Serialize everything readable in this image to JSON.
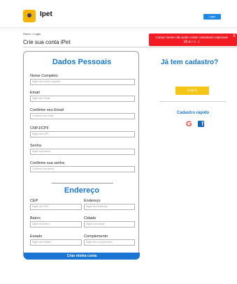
{
  "header": {
    "brand": "Ipet",
    "login_label": "Login"
  },
  "breadcrumb": "Home > Login",
  "page_subtitle": "Crie sua conta iPet",
  "toast": {
    "message": "Campo Nome não pode conter caracteres especiais (@,&,*,A...)",
    "close": "X"
  },
  "personal": {
    "title": "Dados Pessoais",
    "fields": [
      {
        "label": "Nome Completo",
        "placeholder": "Digite seu nome completo"
      },
      {
        "label": "Email",
        "placeholder": "Digite seu Email"
      },
      {
        "label": "Confirme seu Email",
        "placeholder": "Confirme seu email"
      },
      {
        "label": "CNPJ/CPF",
        "placeholder": "Digite seu CPF"
      },
      {
        "label": "Senha",
        "placeholder": "Digite sua senha"
      },
      {
        "label": "Confirme sua senha",
        "placeholder": "Confirme sua senha"
      }
    ]
  },
  "address": {
    "title": "Endereço",
    "fields": [
      {
        "label": "CEP",
        "placeholder": "Digite seu CEP"
      },
      {
        "label": "Endereço",
        "placeholder": "Digite seu endereço"
      },
      {
        "label": "Bairro",
        "placeholder": "Digite seu bairro"
      },
      {
        "label": "Cidade",
        "placeholder": "Digite sua cidade"
      },
      {
        "label": "Estado",
        "placeholder": "Digite seu estado"
      },
      {
        "label": "Complemento",
        "placeholder": "Digite seu complemento"
      }
    ]
  },
  "create_button": "Criar minha conta",
  "sidebar": {
    "title": "Já tem cadastro?",
    "login_button": "Log in",
    "quick_title": "Cadastro rápido",
    "google_glyph": "G",
    "facebook_glyph": "f"
  },
  "icons": {
    "logo": "paw-logo-icon",
    "google": "google-icon",
    "facebook": "facebook-icon"
  },
  "colors": {
    "accent": "#1976d2",
    "logo": "#f5b400",
    "login_button": "#f5c518",
    "toast": "#f21b24"
  }
}
